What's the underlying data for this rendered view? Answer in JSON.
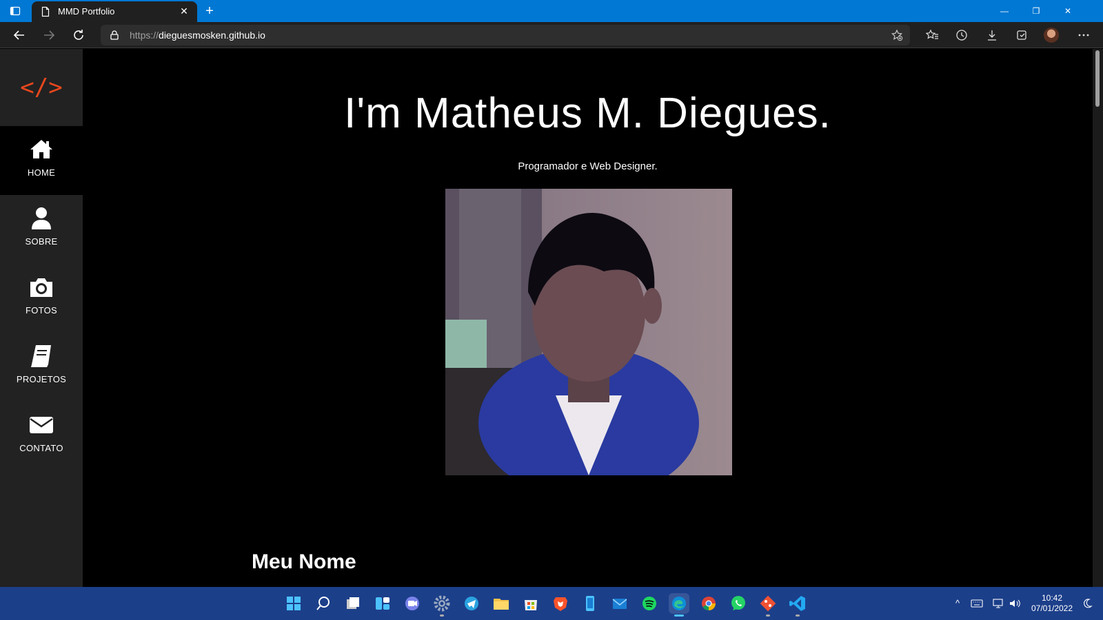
{
  "browser": {
    "tab_title": "MMD Portfolio",
    "tab_close": "✕",
    "new_tab": "+",
    "url_protocol": "https://",
    "url_host": "dieguesmosken.github.io",
    "window_minimize": "—",
    "window_restore": "❐",
    "window_close": "✕"
  },
  "sidebar": {
    "logo": "</>",
    "items": [
      {
        "label": "HOME",
        "icon": "home-icon",
        "active": true
      },
      {
        "label": "SOBRE",
        "icon": "user-icon",
        "active": false
      },
      {
        "label": "FOTOS",
        "icon": "camera-icon",
        "active": false
      },
      {
        "label": "PROJETOS",
        "icon": "book-icon",
        "active": false
      },
      {
        "label": "CONTATO",
        "icon": "envelope-icon",
        "active": false
      }
    ]
  },
  "main": {
    "title": "I'm Matheus M. Diegues.",
    "subtitle": "Programador e Web Designer.",
    "section_title": "Meu Nome"
  },
  "taskbar": {
    "time": "10:42",
    "date": "07/01/2022"
  },
  "colors": {
    "browser_accent": "#0078d4",
    "logo_accent": "#e8471d",
    "taskbar": "#1c3f8a"
  }
}
